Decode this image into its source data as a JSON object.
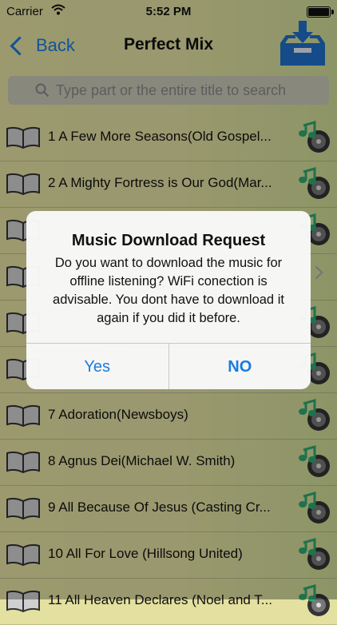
{
  "status_bar": {
    "carrier": "Carrier",
    "time": "5:52 PM"
  },
  "nav": {
    "back_label": "Back",
    "title": "Perfect Mix"
  },
  "search": {
    "placeholder": "Type part or the entire title to search"
  },
  "songs": [
    "1 A Few More Seasons(Old Gospel...",
    "2 A Mighty Fortress is Our God(Mar...",
    "",
    "",
    "",
    "",
    "7 Adoration(Newsboys)",
    "8 Agnus Dei(Michael W. Smith)",
    "9 All Because Of Jesus (Casting Cr...",
    "10 All For Love (Hillsong United)",
    "11 All Heaven Declares (Noel and T..."
  ],
  "dialog": {
    "title": "Music Download Request",
    "message": "Do you want to download the music for offline listening? WiFi conection is advisable. You dont have to download it again if you did it before.",
    "yes_label": "Yes",
    "no_label": "NO"
  },
  "colors": {
    "accent": "#1a7ce0",
    "download_icon": "#1f6fc9",
    "music_note": "#2fa870"
  },
  "icons": {
    "wifi": "wifi-icon",
    "download": "download-tray-icon",
    "search": "search-icon",
    "book": "book-icon",
    "music": "music-note-disc-icon"
  }
}
